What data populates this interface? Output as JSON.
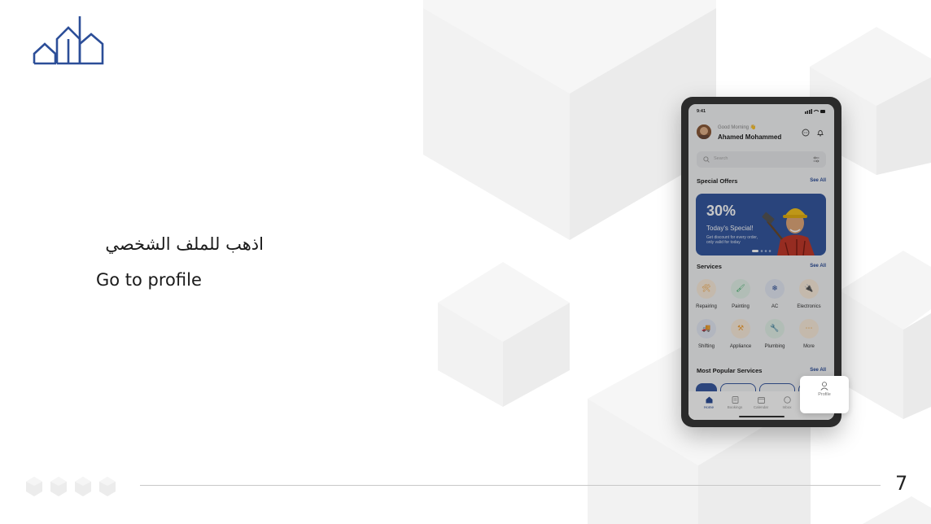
{
  "slide": {
    "caption_ar": "اذهب للملف الشخصي",
    "caption_en": "Go to profile",
    "page_number": "7"
  },
  "colors": {
    "brand_blue": "#2c4e98",
    "cube_light": "#f3f3f3",
    "cube_mid": "#ebebeb",
    "phone_frame": "#2b2b2b"
  },
  "phone": {
    "status_time": "9:41",
    "greeting": "Good Morning 👋",
    "user_name": "Ahamed Mohammed",
    "search_placeholder": "Search",
    "special_offers": {
      "title": "Special Offers",
      "see_all": "See All",
      "discount": "30%",
      "headline": "Today's Special!",
      "description": "Get discount for every order, only valid for today"
    },
    "services": {
      "title": "Services",
      "see_all": "See All",
      "items": [
        {
          "label": "Repairing",
          "icon": "tools-icon",
          "glyph": "🛠",
          "color": "#f3a23a",
          "bg": "#fbeedd"
        },
        {
          "label": "Painting",
          "icon": "paint-roller-icon",
          "glyph": "🖌",
          "color": "#3fae6a",
          "bg": "#e3f3e9"
        },
        {
          "label": "AC",
          "icon": "ac-icon",
          "glyph": "❄",
          "color": "#2c4e98",
          "bg": "#e4e9f5"
        },
        {
          "label": "Electronics",
          "icon": "plug-icon",
          "glyph": "🔌",
          "color": "#f3a23a",
          "bg": "#fbeedd"
        },
        {
          "label": "Shifting",
          "icon": "truck-icon",
          "glyph": "🚚",
          "color": "#2c4e98",
          "bg": "#e4e9f5"
        },
        {
          "label": "Appliance",
          "icon": "appliance-icon",
          "glyph": "⚒",
          "color": "#f3a23a",
          "bg": "#fbeedd"
        },
        {
          "label": "Plumbing",
          "icon": "wrench-icon",
          "glyph": "🔧",
          "color": "#3fae6a",
          "bg": "#e3f3e9"
        },
        {
          "label": "More",
          "icon": "more-icon",
          "glyph": "⋯",
          "color": "#f3a23a",
          "bg": "#fbeedd"
        }
      ]
    },
    "popular": {
      "title": "Most Popular Services",
      "see_all": "See All"
    },
    "nav": [
      {
        "label": "Home",
        "icon": "home-icon"
      },
      {
        "label": "Bookings",
        "icon": "bookings-icon"
      },
      {
        "label": "Calendar",
        "icon": "calendar-icon"
      },
      {
        "label": "Inbox",
        "icon": "inbox-icon"
      },
      {
        "label": "Profile",
        "icon": "profile-icon"
      }
    ]
  },
  "callout": {
    "label": "Profile"
  }
}
